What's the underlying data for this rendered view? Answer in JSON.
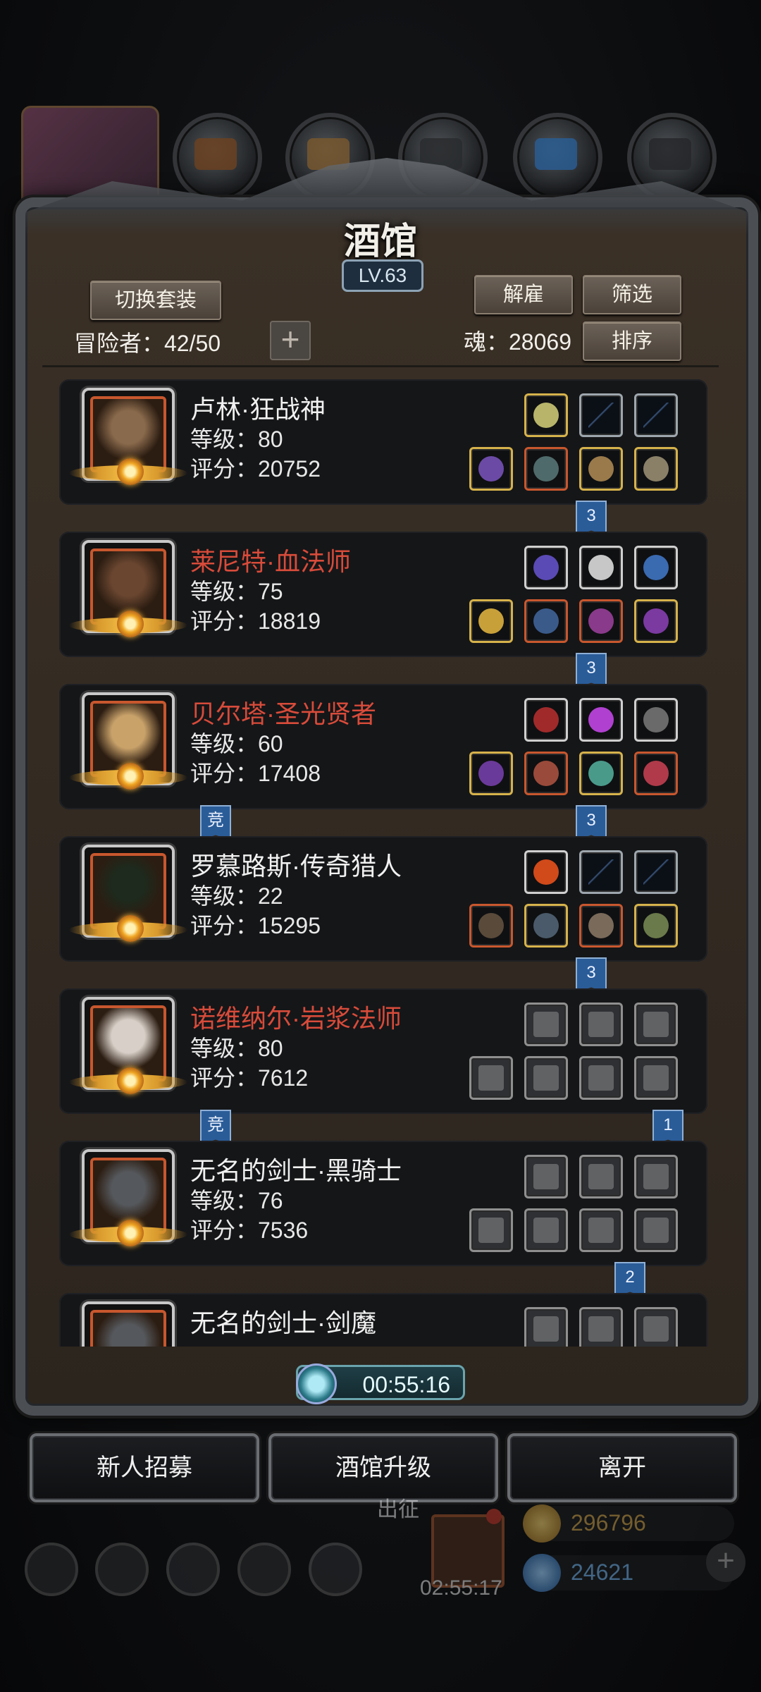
{
  "window": {
    "title": "酒馆",
    "level": "LV.63"
  },
  "toolbar": {
    "switch_set_label": "切换套装",
    "dismiss_label": "解雇",
    "filter_label": "筛选",
    "sort_label": "排序",
    "add_label": "+",
    "adventurers": "冒险者：42/50",
    "souls": "魂：28069"
  },
  "heroes": [
    {
      "name": "卢林·狂战神",
      "level": "等级：80",
      "score": "评分：20752",
      "badge": "3"
    },
    {
      "name": "莱尼特·血法师",
      "level": "等级：75",
      "score": "评分：18819",
      "badge": "3"
    },
    {
      "name": "贝尔塔·圣光贤者",
      "level": "等级：60",
      "score": "评分：17408",
      "badge": "3",
      "arena_tag": "竞"
    },
    {
      "name": "罗慕路斯·传奇猎人",
      "level": "等级：22",
      "score": "评分：15295",
      "badge": "3"
    },
    {
      "name": "诺维纳尔·岩浆法师",
      "level": "等级：80",
      "score": "评分：7612",
      "badge": "1",
      "arena_tag": "竞"
    },
    {
      "name": "无名的剑士·黑骑士",
      "level": "等级：76",
      "score": "评分：7536",
      "badge": "2"
    },
    {
      "name": "无名的剑士·剑魔",
      "level": "",
      "score": ""
    }
  ],
  "timer": "00:55:16",
  "actions": {
    "recruit": "新人招募",
    "upgrade": "酒馆升级",
    "leave": "离开"
  },
  "hud": {
    "expedition": "出征",
    "gift_timer": "02:55:17",
    "gold": "296796",
    "gems": "24621",
    "plus": "+"
  },
  "colors": {
    "accent_red": "#d84b3a",
    "badge_blue": "#2a5c98",
    "gold_frame": "#d6b24b"
  }
}
